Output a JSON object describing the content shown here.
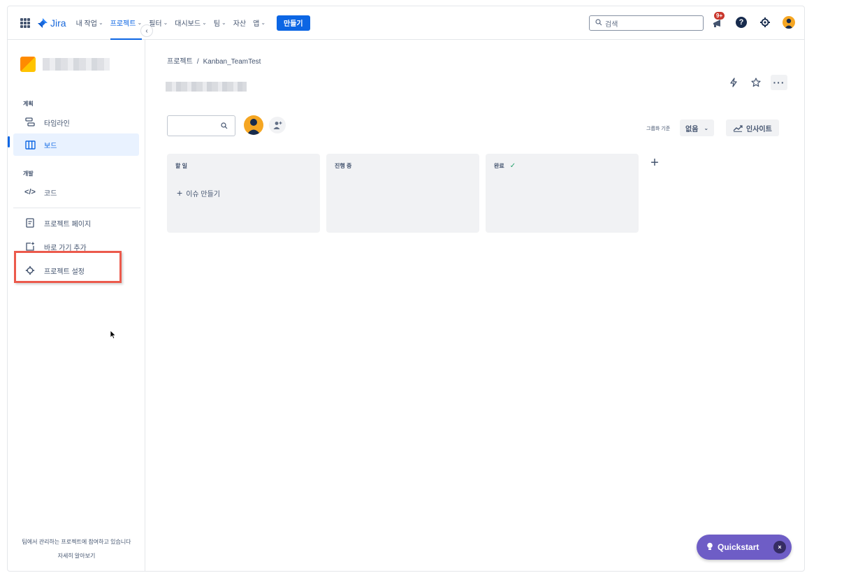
{
  "topnav": {
    "logo_text": "Jira",
    "items": [
      {
        "label": "내 작업",
        "chevron": true
      },
      {
        "label": "프로젝트",
        "chevron": true,
        "active": true
      },
      {
        "label": "필터",
        "chevron": true
      },
      {
        "label": "대시보드",
        "chevron": true
      },
      {
        "label": "팀",
        "chevron": true
      },
      {
        "label": "자산",
        "chevron": false
      },
      {
        "label": "앱",
        "chevron": true
      }
    ],
    "create_label": "만들기",
    "search_placeholder": "검색",
    "notification_badge": "9+",
    "help_icon": "?"
  },
  "sidebar": {
    "sections": {
      "planning": "계획",
      "development": "개발"
    },
    "items": {
      "timeline": "타임라인",
      "board": "보드",
      "code": "코드",
      "project_pages": "프로젝트 페이지",
      "add_shortcut": "바로 가기 추가",
      "project_settings": "프로젝트 설정"
    },
    "footer_text": "팀에서 관리하는 프로젝트에 참여하고 있습니다",
    "footer_link": "자세히 알아보기"
  },
  "main": {
    "breadcrumb": {
      "root": "프로젝트",
      "separator": "/",
      "current": "Kanban_TeamTest"
    },
    "toolbar": {
      "group_by_label": "그룹화 기준",
      "group_by_value": "없음",
      "insights_label": "인사이트",
      "more_label": "···"
    },
    "columns": [
      {
        "title": "할 일",
        "done": false
      },
      {
        "title": "진행 중",
        "done": false
      },
      {
        "title": "완료",
        "done": true
      }
    ],
    "create_issue_label": "이슈 만들기",
    "add_column_symbol": "+"
  },
  "quickstart": {
    "label": "Quickstart",
    "close_symbol": "×"
  },
  "colors": {
    "brand_blue": "#0c66e4",
    "quickstart_purple": "#6e5dc6",
    "highlight_red": "#ec5a4c",
    "avatar_orange": "#f5a623"
  }
}
